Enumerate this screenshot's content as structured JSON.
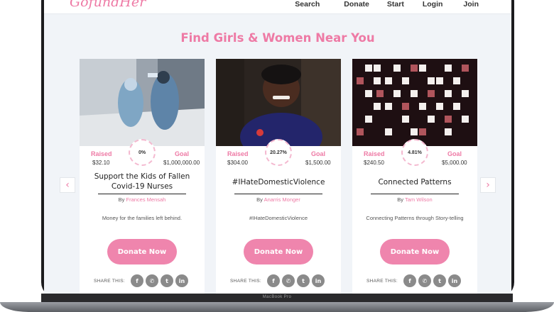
{
  "brand": {
    "logo": "GofundHer"
  },
  "nav": {
    "links": [
      "Search",
      "Donate",
      "Start",
      "Login",
      "Join"
    ]
  },
  "page": {
    "title": "Find Girls & Women Near You"
  },
  "labels": {
    "raised": "Raised",
    "goal": "Goal",
    "by": "By",
    "share": "SHARE THIS:",
    "donate": "Donate Now"
  },
  "carousel": {
    "prev_icon": "chevron-left-icon",
    "next_icon": "chevron-right-icon"
  },
  "share_icons": [
    "facebook-icon",
    "whatsapp-icon",
    "twitter-icon",
    "linkedin-icon"
  ],
  "campaigns": [
    {
      "raised": "$32.10",
      "goal": "$1,000,000.00",
      "percent": "0%",
      "progress": 0,
      "title": "Support the Kids of Fallen Covid-19 Nurses",
      "author": "Frances Mensah",
      "description": "Money for the families left behind."
    },
    {
      "raised": "$304.00",
      "goal": "$1,500.00",
      "percent": "20.27%",
      "progress": 20.27,
      "title": "#IHateDomesticViolence",
      "author": "Anarris Monger",
      "description": "#IHateDomesticViolence"
    },
    {
      "raised": "$240.50",
      "goal": "$5,000.00",
      "percent": "4.81%",
      "progress": 4.81,
      "title": "Connected Patterns",
      "author": "Tam Wilson",
      "description": "Connecting Patterns through Story-telling"
    }
  ],
  "device": {
    "label": "MacBook Pro"
  },
  "colors": {
    "accent": "#ee7aa5",
    "button": "#ef85ad",
    "share_icon": "#8a8a8a"
  }
}
